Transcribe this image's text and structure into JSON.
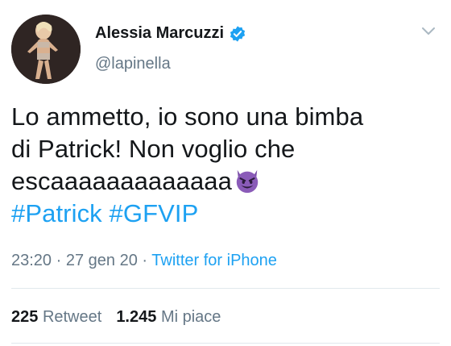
{
  "author": {
    "display_name": "Alessia Marcuzzi",
    "handle": "@lapinella",
    "verified": true
  },
  "tweet": {
    "lines": [
      "Lo ammetto, io sono una bimba",
      "di Patrick! Non voglio che",
      "escaaaaaaaaaaaaa"
    ],
    "emoji": "smiling-devil-emoji",
    "hashtags": [
      "#Patrick",
      "#GFVIP"
    ],
    "time": "23:20",
    "separator": "·",
    "date": "27 gen 20",
    "source": "Twitter for iPhone"
  },
  "stats": {
    "retweet_count": "225",
    "retweet_label": "Retweet",
    "like_count": "1.245",
    "like_label": "Mi piace"
  },
  "colors": {
    "link": "#1da1f2",
    "secondary_text": "#657786",
    "primary_text": "#14171a",
    "emoji_purple": "#7b4fa8"
  }
}
